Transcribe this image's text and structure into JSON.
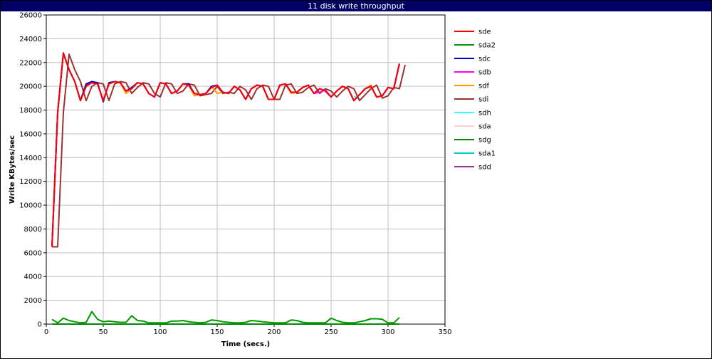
{
  "window": {
    "title": "11 disk write throughput"
  },
  "chart_data": {
    "type": "line",
    "title": "11 disk write throughput",
    "xlabel": "Time (secs.)",
    "ylabel": "Write KBytes/sec",
    "xlim": [
      0,
      350
    ],
    "ylim": [
      0,
      26000
    ],
    "xticks": [
      0,
      50,
      100,
      150,
      200,
      250,
      300,
      350
    ],
    "yticks": [
      0,
      2000,
      4000,
      6000,
      8000,
      10000,
      12000,
      14000,
      16000,
      18000,
      20000,
      22000,
      24000,
      26000
    ],
    "grid": true,
    "legend_position": "right",
    "series": [
      {
        "name": "sde",
        "color": "#ff0000",
        "x": [
          5,
          10,
          15,
          20,
          25,
          30,
          35,
          40,
          45,
          50,
          55,
          60,
          65,
          70,
          75,
          80,
          85,
          90,
          95,
          100,
          105,
          110,
          115,
          120,
          125,
          130,
          135,
          140,
          145,
          150,
          155,
          160,
          165,
          170,
          175,
          180,
          185,
          190,
          195,
          200,
          205,
          210,
          215,
          220,
          225,
          230,
          235,
          240,
          245,
          250,
          255,
          260,
          265,
          270,
          275,
          280,
          285,
          290,
          295,
          300,
          305,
          310
        ],
        "y": [
          6500,
          17800,
          22800,
          21400,
          20400,
          18800,
          20000,
          20300,
          20200,
          18800,
          20200,
          20400,
          20300,
          19600,
          19800,
          20300,
          20200,
          19400,
          19100,
          20300,
          20200,
          19400,
          19600,
          20200,
          20100,
          19400,
          19300,
          19400,
          19900,
          20100,
          19500,
          19400,
          20000,
          19700,
          18900,
          19800,
          20100,
          20000,
          18900,
          18900,
          20100,
          20200,
          19500,
          19500,
          19900,
          20100,
          19400,
          19800,
          19600,
          19100,
          19600,
          20000,
          19800,
          18800,
          19300,
          19800,
          20000,
          19100,
          19200,
          19900,
          19800,
          21900
        ]
      },
      {
        "name": "sda2",
        "color": "#009900",
        "x": [
          5,
          10,
          15,
          20,
          25,
          30,
          35,
          40,
          45,
          50,
          55,
          60,
          65,
          70,
          75,
          80,
          85,
          90,
          95,
          100,
          105,
          110,
          115,
          120,
          125,
          130,
          135,
          140,
          145,
          150,
          155,
          160,
          165,
          170,
          175,
          180,
          185,
          190,
          195,
          200,
          205,
          210,
          215,
          220,
          225,
          230,
          235,
          240,
          245,
          250,
          255,
          260,
          265,
          270,
          275,
          280,
          285,
          290,
          295,
          300,
          305,
          310
        ],
        "y": [
          400,
          100,
          500,
          300,
          200,
          100,
          150,
          1050,
          400,
          200,
          250,
          200,
          150,
          150,
          700,
          300,
          250,
          100,
          100,
          100,
          100,
          250,
          250,
          300,
          200,
          150,
          100,
          150,
          350,
          300,
          200,
          150,
          100,
          100,
          150,
          300,
          250,
          200,
          150,
          100,
          100,
          100,
          350,
          300,
          150,
          100,
          100,
          100,
          100,
          500,
          300,
          150,
          100,
          100,
          200,
          300,
          450,
          450,
          400,
          100,
          100,
          550
        ]
      },
      {
        "name": "sdc",
        "color": "#0000cc",
        "x": [
          5,
          10,
          15,
          20,
          25,
          30,
          35,
          40,
          45,
          50,
          55,
          60,
          65,
          70,
          75,
          80,
          85,
          90,
          95,
          100,
          105,
          110,
          115,
          120,
          125,
          130,
          135,
          140,
          145,
          150,
          155,
          160,
          165,
          170,
          175,
          180,
          185,
          190,
          195,
          200,
          205,
          210,
          215,
          220,
          225,
          230,
          235,
          240,
          245,
          250,
          255,
          260,
          265,
          270,
          275,
          280,
          285,
          290,
          295,
          300,
          305,
          310
        ],
        "y": [
          6500,
          17800,
          22800,
          21400,
          20400,
          18800,
          20200,
          20400,
          20300,
          18700,
          20300,
          20400,
          20300,
          19600,
          19900,
          20300,
          20200,
          19400,
          19100,
          20300,
          20200,
          19400,
          19600,
          20200,
          20200,
          19400,
          19300,
          19400,
          20000,
          20100,
          19500,
          19400,
          20000,
          19700,
          18900,
          19800,
          20100,
          20000,
          18900,
          18900,
          20100,
          20200,
          19500,
          19500,
          19900,
          20100,
          19400,
          19800,
          19600,
          19100,
          19600,
          20000,
          19800,
          18800,
          19300,
          19800,
          20000,
          19100,
          19200,
          19900,
          19800,
          21900
        ]
      },
      {
        "name": "sdb",
        "color": "#ff00ff",
        "x": [
          5,
          10,
          15,
          20,
          25,
          30,
          35,
          40,
          45,
          50,
          55,
          60,
          65,
          70,
          75,
          80,
          85,
          90,
          95,
          100,
          105,
          110,
          115,
          120,
          125,
          130,
          135,
          140,
          145,
          150,
          155,
          160,
          165,
          170,
          175,
          180,
          185,
          190,
          195,
          200,
          205,
          210,
          215,
          220,
          225,
          230,
          235,
          240,
          245,
          250,
          255,
          260,
          265,
          270,
          275,
          280,
          285,
          290,
          295,
          300,
          305,
          310
        ],
        "y": [
          6500,
          17800,
          22800,
          21400,
          20400,
          18800,
          20100,
          20300,
          20200,
          18800,
          20200,
          20400,
          20300,
          19600,
          19800,
          20300,
          20200,
          19400,
          19100,
          20300,
          20200,
          19400,
          19600,
          20200,
          20100,
          19400,
          19300,
          19400,
          19900,
          20100,
          19500,
          19400,
          20000,
          19700,
          18900,
          19800,
          20100,
          20000,
          18900,
          18900,
          20100,
          20200,
          19500,
          19500,
          19900,
          20100,
          19400,
          19500,
          19700,
          19100,
          19600,
          20000,
          19800,
          18800,
          19300,
          19800,
          20000,
          19100,
          19200,
          19900,
          19800,
          21900
        ]
      },
      {
        "name": "sdf",
        "color": "#ff9900",
        "x": [
          5,
          10,
          15,
          20,
          25,
          30,
          35,
          40,
          45,
          50,
          55,
          60,
          65,
          70,
          75,
          80,
          85,
          90,
          95,
          100,
          105,
          110,
          115,
          120,
          125,
          130,
          135,
          140,
          145,
          150,
          155,
          160,
          165,
          170,
          175,
          180,
          185,
          190,
          195,
          200,
          205,
          210,
          215,
          220,
          225,
          230,
          235,
          240,
          245,
          250,
          255,
          260,
          265,
          270,
          275,
          280,
          285,
          290,
          295,
          300,
          305,
          310
        ],
        "y": [
          6500,
          17800,
          22800,
          21400,
          20400,
          18800,
          20000,
          20300,
          20200,
          18800,
          20200,
          20400,
          20300,
          19400,
          19800,
          20300,
          20200,
          19400,
          19100,
          20300,
          20200,
          19400,
          19600,
          20200,
          20100,
          19200,
          19300,
          19400,
          20000,
          19400,
          19500,
          19400,
          20000,
          19700,
          18900,
          19800,
          20100,
          20000,
          18900,
          18900,
          20100,
          20200,
          19400,
          19500,
          19900,
          20100,
          19400,
          19800,
          19600,
          19100,
          19600,
          20000,
          19800,
          18800,
          19300,
          19800,
          20100,
          19100,
          19200,
          19900,
          19800,
          21900
        ]
      },
      {
        "name": "sdi",
        "color": "#993333",
        "x": [
          5,
          10,
          15,
          20,
          25,
          30,
          35,
          40,
          45,
          50,
          55,
          60,
          65,
          70,
          75,
          80,
          85,
          90,
          95,
          100,
          105,
          110,
          115,
          120,
          125,
          130,
          135,
          140,
          145,
          150,
          155,
          160,
          165,
          170,
          175,
          180,
          185,
          190,
          195,
          200,
          205,
          210,
          215,
          220,
          225,
          230,
          235,
          240,
          245,
          250,
          255,
          260,
          265,
          270,
          275,
          280,
          285,
          290,
          295,
          300,
          305,
          310,
          315
        ],
        "y": [
          6500,
          6500,
          17800,
          22700,
          21400,
          20400,
          18800,
          20000,
          20300,
          20200,
          18800,
          20200,
          20400,
          20300,
          19400,
          19900,
          20300,
          20200,
          19400,
          19100,
          20300,
          20200,
          19400,
          19600,
          20200,
          20100,
          19200,
          19300,
          19400,
          20000,
          19400,
          19500,
          19400,
          20000,
          19700,
          18900,
          19800,
          20100,
          20000,
          18900,
          18900,
          20100,
          20200,
          19400,
          19500,
          19900,
          20100,
          19400,
          19800,
          19600,
          19100,
          19600,
          20000,
          19800,
          18800,
          19300,
          19800,
          20100,
          19000,
          19200,
          19900,
          19800,
          21800
        ]
      },
      {
        "name": "sdh",
        "color": "#33ffff",
        "x": [
          270,
          275
        ],
        "y": [
          19200,
          18900
        ]
      },
      {
        "name": "sda",
        "color": "#ffcccc",
        "x": [],
        "y": []
      },
      {
        "name": "sdg",
        "color": "#008800",
        "x": [
          5,
          310
        ],
        "y": [
          0,
          0
        ]
      },
      {
        "name": "sda1",
        "color": "#00cccc",
        "x": [
          5,
          310
        ],
        "y": [
          0,
          0
        ]
      },
      {
        "name": "sdd",
        "color": "#993399",
        "x": [],
        "y": []
      }
    ]
  }
}
